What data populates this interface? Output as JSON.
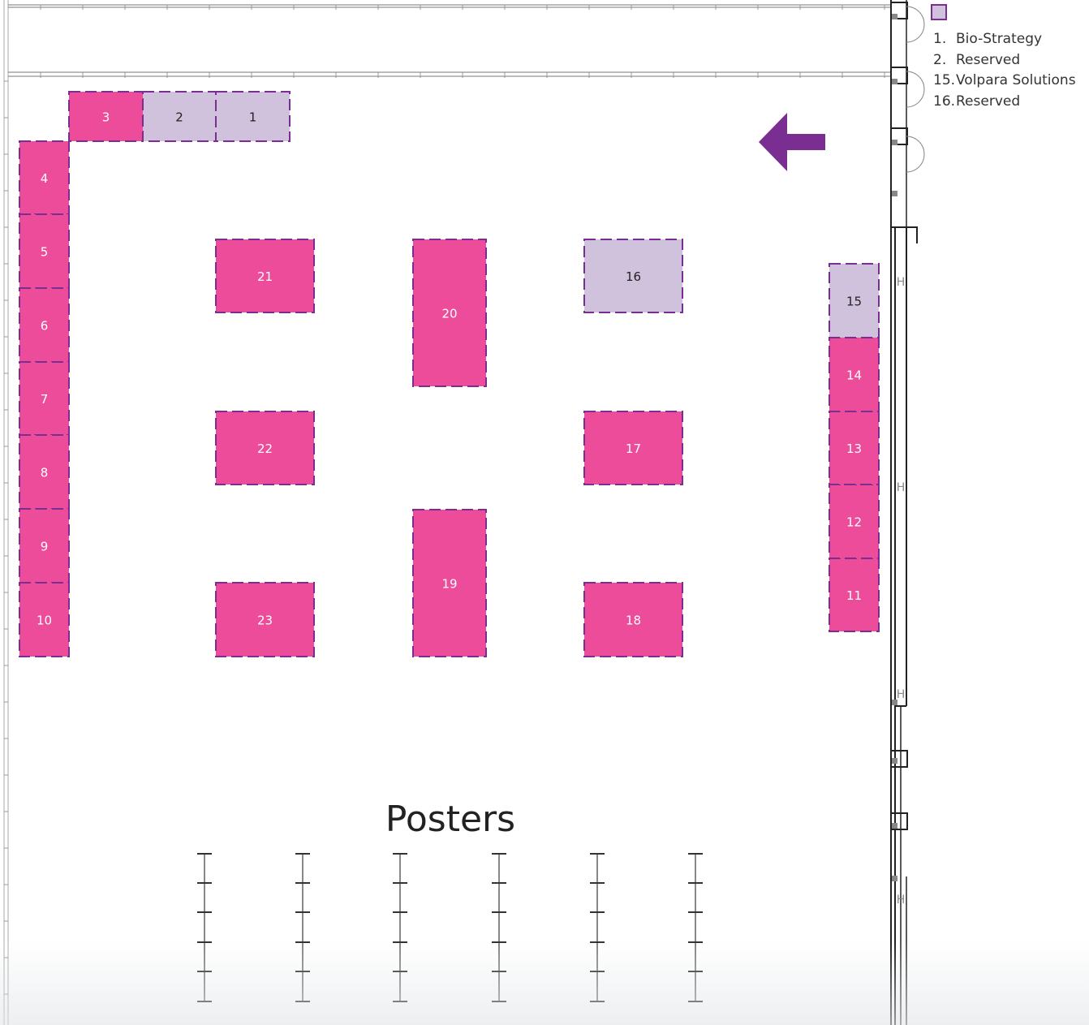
{
  "colors": {
    "occupied": "#ec4c9a",
    "reserved": "#d0c1dd",
    "outline": "#7b2e92",
    "arrow": "#7b2e92",
    "wall": "#222222"
  },
  "legend": {
    "swatch_color": "#d0c1dd",
    "items": [
      {
        "num": "1.",
        "label": "Bio-Strategy"
      },
      {
        "num": "2.",
        "label": "Reserved"
      },
      {
        "num": "15.",
        "label": "Volpara Solutions"
      },
      {
        "num": "16.",
        "label": "Reserved"
      }
    ]
  },
  "entry_arrow": {
    "direction": "left"
  },
  "booths": [
    {
      "id": "1",
      "status": "reserved"
    },
    {
      "id": "2",
      "status": "reserved"
    },
    {
      "id": "3",
      "status": "occupied"
    },
    {
      "id": "4",
      "status": "occupied"
    },
    {
      "id": "5",
      "status": "occupied"
    },
    {
      "id": "6",
      "status": "occupied"
    },
    {
      "id": "7",
      "status": "occupied"
    },
    {
      "id": "8",
      "status": "occupied"
    },
    {
      "id": "9",
      "status": "occupied"
    },
    {
      "id": "10",
      "status": "occupied"
    },
    {
      "id": "11",
      "status": "occupied"
    },
    {
      "id": "12",
      "status": "occupied"
    },
    {
      "id": "13",
      "status": "occupied"
    },
    {
      "id": "14",
      "status": "occupied"
    },
    {
      "id": "15",
      "status": "reserved"
    },
    {
      "id": "16",
      "status": "reserved"
    },
    {
      "id": "17",
      "status": "occupied"
    },
    {
      "id": "18",
      "status": "occupied"
    },
    {
      "id": "19",
      "status": "occupied"
    },
    {
      "id": "20",
      "status": "occupied"
    },
    {
      "id": "21",
      "status": "occupied"
    },
    {
      "id": "22",
      "status": "occupied"
    },
    {
      "id": "23",
      "status": "occupied"
    }
  ],
  "posters": {
    "title": "Posters",
    "boards": 6
  }
}
